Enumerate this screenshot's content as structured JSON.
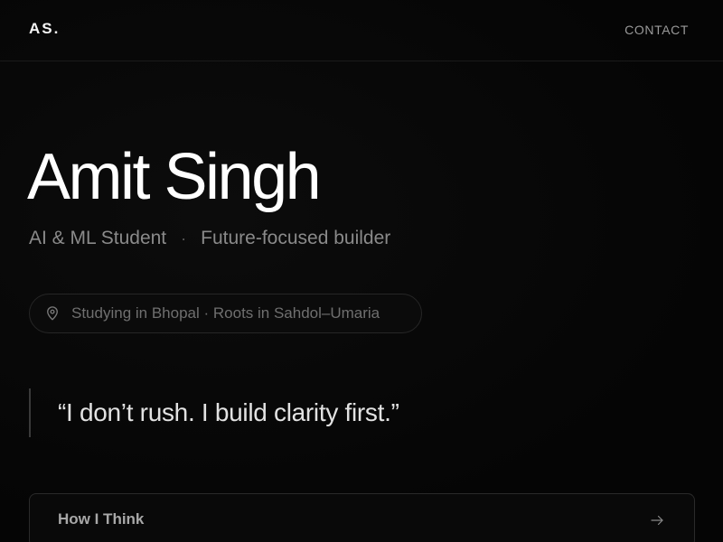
{
  "header": {
    "logo": "AS.",
    "contact_label": "CONTACT"
  },
  "hero": {
    "name": "Amit Singh",
    "role_primary": "AI & ML Student",
    "role_separator": "·",
    "role_secondary": "Future-focused builder",
    "location": "Studying in Bhopal · Roots in Sahdol–Umaria",
    "quote": "“I don’t rush. I build clarity first.”"
  },
  "cards": {
    "how_i_think_label": "How I Think"
  },
  "icons": {
    "location": "map-pin-icon",
    "card_arrow": "arrow-right-icon"
  },
  "colors": {
    "background": "#050505",
    "text_primary": "#ffffff",
    "text_muted": "#8a8a8a",
    "border": "#262626"
  }
}
